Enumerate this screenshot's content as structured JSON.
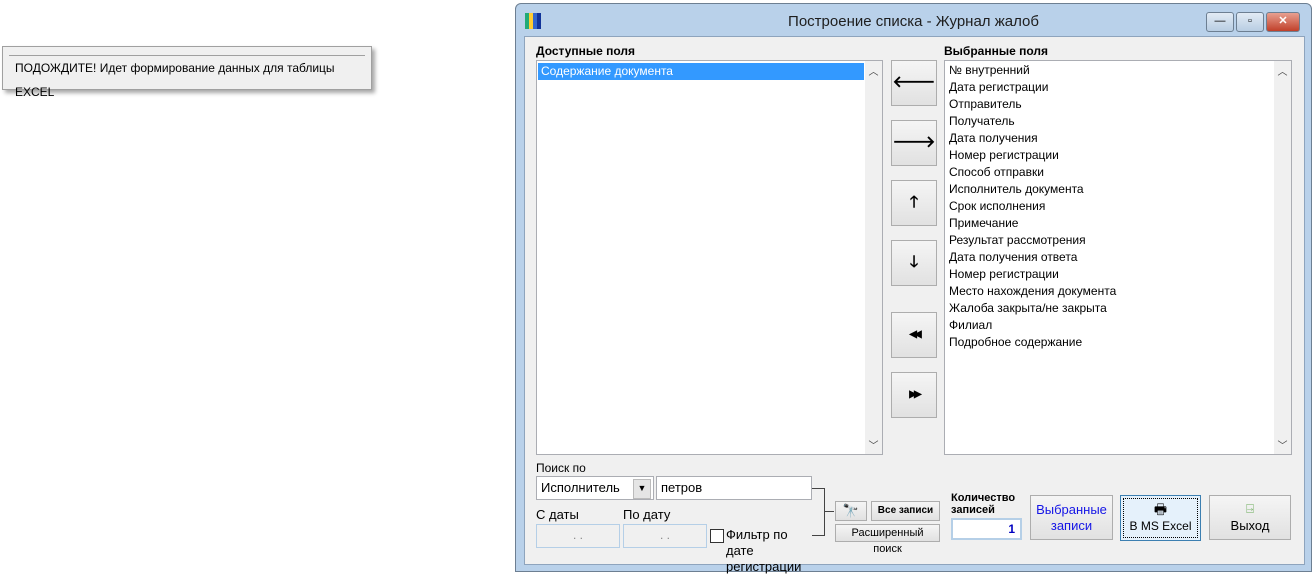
{
  "wait_popup": {
    "message": "ПОДОЖДИТЕ! Идет формирование данных для таблицы EXCEL"
  },
  "window": {
    "title": "Построение списка - Журнал жалоб",
    "minimize": "—",
    "maximize": "▫",
    "close": "✕"
  },
  "available": {
    "label": "Доступные поля",
    "items": [
      "Содержание документа"
    ]
  },
  "selected": {
    "label": "Выбранные поля",
    "items": [
      "№ внутренний",
      "Дата регистрации",
      "Отправитель",
      "Получатель",
      "Дата получения",
      "Номер регистрации",
      "Способ отправки",
      "Исполнитель документа",
      "Срок исполнения",
      "Примечание",
      "Результат рассмотрения",
      "Дата получения ответа",
      "Номер регистрации",
      "Место нахождения документа",
      "Жалоба закрыта/не закрыта",
      "Филиал",
      "Подробное содержание"
    ]
  },
  "arrows": {
    "left": "🡐",
    "right": "🡒",
    "up": "🡑",
    "down": "🡓",
    "all_left": "◀◀",
    "all_right": "▶▶"
  },
  "search": {
    "label": "Поиск по",
    "field": "Исполнитель",
    "value": "петров",
    "from_label": "С даты",
    "to_label": "По дату",
    "from_value": ". .",
    "to_value": ". .",
    "filter_label": "Фильтр по дате регистрации",
    "all_records": "Все записи",
    "advanced": "Расширенный поиск"
  },
  "count": {
    "label": "Количество записей",
    "value": "1"
  },
  "buttons": {
    "selected_records": "Выбранные записи",
    "excel": "В MS Excel",
    "exit": "Выход"
  }
}
